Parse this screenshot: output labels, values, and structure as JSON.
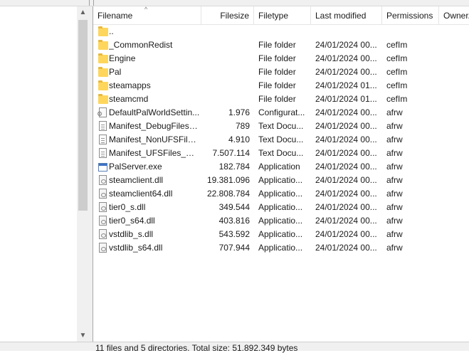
{
  "columns": {
    "filename": "Filename",
    "filesize": "Filesize",
    "filetype": "Filetype",
    "last_modified": "Last modified",
    "permissions": "Permissions",
    "owner": "Owner/..."
  },
  "sort_indicator": "^",
  "scroll": {
    "up": "▲",
    "down": "▼"
  },
  "files": [
    {
      "name": "..",
      "size": "",
      "type": "",
      "modified": "",
      "perm": "",
      "icon": "folder-icon"
    },
    {
      "name": "_CommonRedist",
      "size": "",
      "type": "File folder",
      "modified": "24/01/2024 00...",
      "perm": "cefIm",
      "icon": "folder-icon"
    },
    {
      "name": "Engine",
      "size": "",
      "type": "File folder",
      "modified": "24/01/2024 00...",
      "perm": "cefIm",
      "icon": "folder-icon"
    },
    {
      "name": "Pal",
      "size": "",
      "type": "File folder",
      "modified": "24/01/2024 00...",
      "perm": "cefIm",
      "icon": "folder-icon"
    },
    {
      "name": "steamapps",
      "size": "",
      "type": "File folder",
      "modified": "24/01/2024 01...",
      "perm": "cefIm",
      "icon": "folder-icon"
    },
    {
      "name": "steamcmd",
      "size": "",
      "type": "File folder",
      "modified": "24/01/2024 01...",
      "perm": "cefIm",
      "icon": "folder-icon"
    },
    {
      "name": "DefaultPalWorldSettin...",
      "size": "1.976",
      "type": "Configurat...",
      "modified": "24/01/2024 00...",
      "perm": "afrw",
      "icon": "config-file-icon"
    },
    {
      "name": "Manifest_DebugFiles_...",
      "size": "789",
      "type": "Text Docu...",
      "modified": "24/01/2024 00...",
      "perm": "afrw",
      "icon": "text-document-icon"
    },
    {
      "name": "Manifest_NonUFSFiles...",
      "size": "4.910",
      "type": "Text Docu...",
      "modified": "24/01/2024 00...",
      "perm": "afrw",
      "icon": "text-document-icon"
    },
    {
      "name": "Manifest_UFSFiles_Wi...",
      "size": "7.507.114",
      "type": "Text Docu...",
      "modified": "24/01/2024 00...",
      "perm": "afrw",
      "icon": "text-document-icon"
    },
    {
      "name": "PalServer.exe",
      "size": "182.784",
      "type": "Application",
      "modified": "24/01/2024 00...",
      "perm": "afrw",
      "icon": "application-icon"
    },
    {
      "name": "steamclient.dll",
      "size": "19.381.096",
      "type": "Applicatio...",
      "modified": "24/01/2024 00...",
      "perm": "afrw",
      "icon": "dll-file-icon"
    },
    {
      "name": "steamclient64.dll",
      "size": "22.808.784",
      "type": "Applicatio...",
      "modified": "24/01/2024 00...",
      "perm": "afrw",
      "icon": "dll-file-icon"
    },
    {
      "name": "tier0_s.dll",
      "size": "349.544",
      "type": "Applicatio...",
      "modified": "24/01/2024 00...",
      "perm": "afrw",
      "icon": "dll-file-icon"
    },
    {
      "name": "tier0_s64.dll",
      "size": "403.816",
      "type": "Applicatio...",
      "modified": "24/01/2024 00...",
      "perm": "afrw",
      "icon": "dll-file-icon"
    },
    {
      "name": "vstdlib_s.dll",
      "size": "543.592",
      "type": "Applicatio...",
      "modified": "24/01/2024 00...",
      "perm": "afrw",
      "icon": "dll-file-icon"
    },
    {
      "name": "vstdlib_s64.dll",
      "size": "707.944",
      "type": "Applicatio...",
      "modified": "24/01/2024 00...",
      "perm": "afrw",
      "icon": "dll-file-icon"
    }
  ],
  "status_bar": "11 files and 5 directories. Total size: 51.892.349 bytes"
}
